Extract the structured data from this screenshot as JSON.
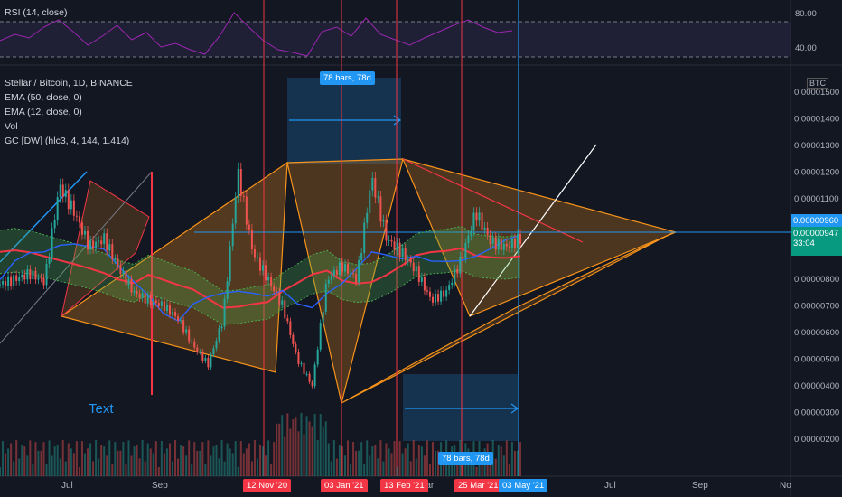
{
  "chart_data": {
    "type": "line",
    "title": "Stellar / Bitcoin, 1D, BINANCE",
    "currency": "BTC",
    "indicators": [
      "EMA (50, close, 0)",
      "EMA (12, close, 0)",
      "Vol",
      "GC [DW] (hlc3, 4, 144, 1.414)"
    ],
    "rsi": {
      "label": "RSI (14, close)",
      "levels": [
        "80.00",
        "40.00"
      ],
      "range": [
        0,
        100
      ]
    },
    "y_ticks": [
      "0.00001500",
      "0.00001400",
      "0.00001300",
      "0.00001200",
      "0.00001100",
      "0.00001000",
      "0.00000900",
      "0.00000800",
      "0.00000700",
      "0.00000600",
      "0.00000500",
      "0.00000400",
      "0.00000300",
      "0.00000200"
    ],
    "ylim": [
      1.6e-06,
      1.54e-05
    ],
    "x_ticks": [
      "Jul",
      "Sep",
      "Mar",
      "Jul",
      "Sep",
      "No"
    ],
    "date_markers": [
      "12 Nov '20",
      "03 Jan '21",
      "13 Feb '21",
      "25 Mar '21",
      "03 May '21"
    ],
    "price_tags": [
      {
        "label": "0.00000960",
        "value": 9.6e-06
      },
      {
        "label": "0.00000947",
        "sub": "33:04",
        "value": 9.47e-06
      }
    ],
    "measures": [
      {
        "label": "78 bars, 78d"
      },
      {
        "label": "78 bars, 78d"
      }
    ],
    "annotation": "Text",
    "colors": {
      "background": "#131722",
      "rsi": "#9c27b0",
      "ema50": "#f23645",
      "ema12": "#2962ff",
      "up": "#26a69a",
      "down": "#ef5350",
      "triangle": "#f7931a",
      "marker": "#f23645",
      "blue_tag": "#2196f3",
      "green_tag": "#089981"
    },
    "series": [
      {
        "values": [
          7.8e-06,
          8e-06,
          8.2e-06,
          7.9e-06,
          1.15e-05,
          1.05e-05,
          9.2e-06,
          9.5e-06,
          8.4e-06,
          7.5e-06,
          7.2e-06,
          7e-06,
          6.5e-06,
          5.5e-06,
          4.8e-06,
          6.5e-06,
          1.2e-05,
          9e-06,
          8e-06,
          7e-06,
          5e-06,
          4e-06,
          8e-06,
          8.5e-06,
          8e-06,
          1.18e-05,
          9.5e-06,
          9e-06,
          8.3e-06,
          7.2e-06,
          7.5e-06,
          8.7e-06,
          1.05e-05,
          9.4e-06,
          9.2e-06,
          9.5e-06
        ]
      }
    ]
  }
}
